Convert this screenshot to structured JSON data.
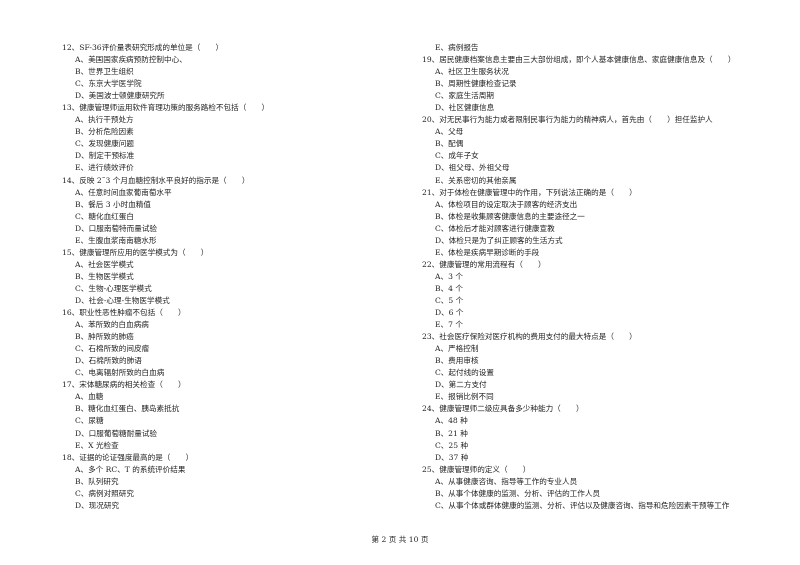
{
  "left_column": [
    {
      "q": "12、SF-36评价量表研究形成的单位是（　　）",
      "options": [
        "A、美国国家疾病预防控制中心、",
        "B、世界卫生组织",
        "C、东京大学医学院",
        "D、美国波士顿健康研究所"
      ]
    },
    {
      "q": "13、健康管理师运用软件育理功策的服务路检不包括（　　）",
      "options": [
        "A、执行干预处方",
        "B、分析危险因素",
        "C、发现健康问题",
        "D、制定干预标准",
        "E、进行绩效评价"
      ]
    },
    {
      "q": "14、反映 2˜3 个月血糖控制水平良好的指示是（　　）",
      "options": [
        "A、任意时间血家葡南萄水平",
        "B、餐后 3 小时血精值",
        "C、糖化血红蛋白",
        "D、口服南萄特而量试验",
        "E、生腹血浆南南糖水形"
      ]
    },
    {
      "q": "15、健康管理所应用的医学模式为（　　）",
      "options": [
        "A、社会医学模式",
        "B、生物医学模式",
        "C、生物-心理医学模式",
        "D、社会-心理-生物医学模式"
      ]
    },
    {
      "q": "16、职业性恶性肿瘤不包括（　　）",
      "options": [
        "A、苯所致的白血病病",
        "B、肿所致的肺癌",
        "C、石棉所致的间皮瘤",
        "D、石棉所致的肺语",
        "C、电离辐射所致的白血病"
      ]
    },
    {
      "q": "17、宋体糖尿病的相关检查（　　）",
      "options": [
        "A、血糖",
        "B、糖化血红蛋白、胰岛素抵抗",
        "C、尿糖",
        "D、口服葡萄糖耐量试验",
        "E、X 光检查"
      ]
    },
    {
      "q": "18、证据的论证强度最高的是（　　）",
      "options": [
        "A、多个 RC、T 的系统评价结果",
        "B、队列研究",
        "C、病例对照研究",
        "D、现况研究"
      ]
    }
  ],
  "right_column": [
    {
      "q": "",
      "options": [
        "E、病例报告"
      ]
    },
    {
      "q": "19、居民健康档案信息主要由三大部份组成，即个人基本健康信息、家庭健康信息及（　　）",
      "options": [
        "A、社区卫生服务状况",
        "B、周期性健康检查记录",
        "C、家庭生活周期",
        "D、社区健康信息"
      ]
    },
    {
      "q": "20、对无民事行为能力或者限制民事行为能力的精神病人，首先由（　　）担任监护人",
      "options": [
        "A、父母",
        "B、配偶",
        "C、成年子女",
        "D、祖父母、外祖父母",
        "E、关系密切的其他亲属"
      ]
    },
    {
      "q": "21、对于体检在健康管理中的作用，下列说法正确的是（　　）",
      "options": [
        "A、体检项目的设定取决于顾客的经济支出",
        "B、体检是收集顾客健康信息的主要途径之一",
        "C、体检后才能对顾客进行健康宣教",
        "D、体检只是为了纠正顾客的生活方式",
        "E、体检是疾病早期诊断的手段"
      ]
    },
    {
      "q": "22、健康管理的常用流程有（　　）",
      "options": [
        "A、3 个",
        "B、4 个",
        "C、5 个",
        "D、6 个",
        "E、7 个"
      ]
    },
    {
      "q": "23、社会医疗保险对医疗机构的费用支付的最大特点是（　　）",
      "options": [
        "A、严格控制",
        "B、费用审核",
        "C、起付线的设置",
        "D、第二方支付",
        "E、报销比例不同"
      ]
    },
    {
      "q": "24、健康管理师二级应具备多少种能力（　　）",
      "options": [
        "A、48 种",
        "B、21 种",
        "C、25 种",
        "D、37 种"
      ]
    },
    {
      "q": "25、健康管理师的定义（　　）",
      "options": [
        "A、从事健康咨询、指导等工作的专业人员",
        "B、从事个体健康的监测、分析、评估的工作人员",
        "C、从事个体或群体健康的监测、分析、评估以及健康咨询、指导和危险因素干预等工作"
      ]
    }
  ],
  "footer": "第 2 页 共 10 页"
}
